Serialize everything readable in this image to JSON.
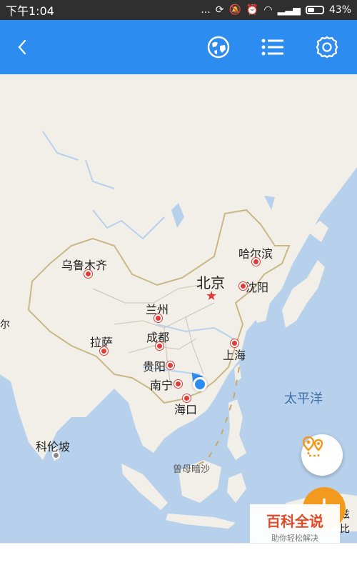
{
  "status_bar": {
    "time": "下午1:04",
    "dots": "...",
    "battery_percent": "43%",
    "battery_level": 0.43
  },
  "toolbar": {
    "back_icon": "chevron-left-icon",
    "globe_icon": "globe-icon",
    "list_icon": "list-icon",
    "settings_icon": "gear-icon",
    "accent_color": "#2d8cf0"
  },
  "map": {
    "cities": [
      {
        "name": "乌鲁木齐"
      },
      {
        "name": "北京"
      },
      {
        "name": "哈尔滨"
      },
      {
        "name": "沈阳"
      },
      {
        "name": "兰州"
      },
      {
        "name": "拉萨"
      },
      {
        "name": "成都"
      },
      {
        "name": "上海"
      },
      {
        "name": "贵阳"
      },
      {
        "name": "南宁"
      },
      {
        "name": "海口"
      },
      {
        "name": "科伦坡"
      }
    ],
    "ocean_label": "太平洋",
    "island_label": "曾母暗沙",
    "edge_text_left": "尔",
    "edge_text_right": "兹比"
  },
  "watermark": {
    "title": "百科全说",
    "subtitle": "助你轻松解决"
  },
  "fab": {
    "plus_label": "+"
  }
}
